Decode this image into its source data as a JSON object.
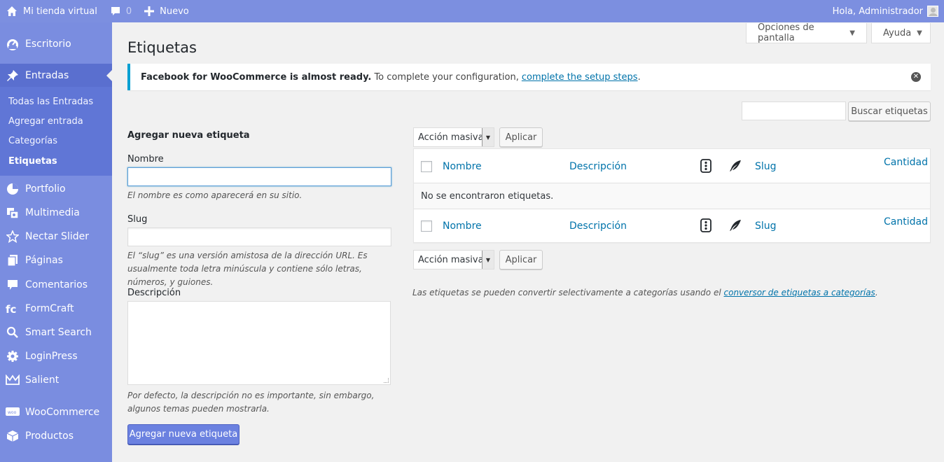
{
  "adminbar": {
    "site_name": "Mi tienda virtual",
    "comments_count": "0",
    "new_label": "Nuevo",
    "greeting": "Hola, Administrador"
  },
  "sidebar": {
    "items": [
      {
        "label": "Escritorio",
        "icon": "dashboard-icon"
      },
      {
        "label": "Entradas",
        "icon": "pin-icon"
      },
      {
        "label": "Portfolio",
        "icon": "portfolio-icon"
      },
      {
        "label": "Multimedia",
        "icon": "media-icon"
      },
      {
        "label": "Nectar Slider",
        "icon": "star-icon"
      },
      {
        "label": "Páginas",
        "icon": "pages-icon"
      },
      {
        "label": "Comentarios",
        "icon": "comments-icon"
      },
      {
        "label": "FormCraft",
        "icon": "formcraft-icon"
      },
      {
        "label": "Smart Search",
        "icon": "search-icon"
      },
      {
        "label": "LoginPress",
        "icon": "gear-icon"
      },
      {
        "label": "Salient",
        "icon": "crown-icon"
      },
      {
        "label": "WooCommerce",
        "icon": "woo-icon"
      },
      {
        "label": "Productos",
        "icon": "box-icon"
      }
    ],
    "submenu": [
      "Todas las Entradas",
      "Agregar entrada",
      "Categorías",
      "Etiquetas"
    ]
  },
  "screen_options": {
    "options_label": "Opciones de pantalla",
    "help_label": "Ayuda"
  },
  "page_title": "Etiquetas",
  "notice": {
    "bold": "Facebook for WooCommerce is almost ready.",
    "text": "To complete your configuration,",
    "link": "complete the setup steps",
    "end": "."
  },
  "search": {
    "button": "Buscar etiquetas"
  },
  "form": {
    "title": "Agregar nueva etiqueta",
    "name_label": "Nombre",
    "name_help": "El nombre es como aparecerá en su sitio.",
    "slug_label": "Slug",
    "slug_help": "El “slug” es una versión amistosa de la dirección URL. Es usualmente toda letra minúscula y contiene sólo letras, números, y guiones.",
    "desc_label": "Descripción",
    "desc_help": "Por defecto, la descripción no es importante, sin embargo, algunos temas pueden mostrarla.",
    "submit": "Agregar nueva etiqueta"
  },
  "bulk": {
    "select_label": "Acción masiva",
    "apply_label": "Aplicar"
  },
  "table": {
    "columns": {
      "name": "Nombre",
      "description": "Descripción",
      "slug": "Slug",
      "count": "Cantidad"
    },
    "empty": "No se encontraron etiquetas."
  },
  "footnote": {
    "text": "Las etiquetas se pueden convertir selectivamente a categorías usando el",
    "link": "conversor de etiquetas a categorías",
    "end": "."
  }
}
